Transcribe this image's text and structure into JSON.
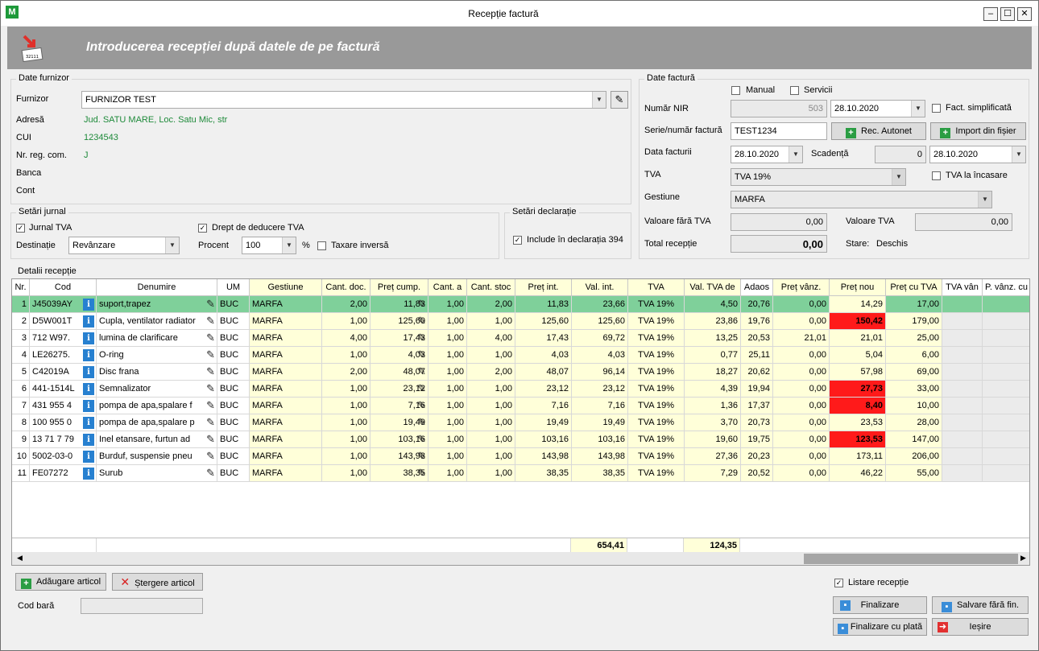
{
  "window": {
    "title": "Recepție factură",
    "app_icon": "app-logo-icon"
  },
  "banner": {
    "heading": "Introducerea recepției după datele de pe factură",
    "icon_text": "32111"
  },
  "supplier": {
    "group": "Date furnizor",
    "lbl_furnizor": "Furnizor",
    "furnizor": "FURNIZOR TEST",
    "lbl_adresa": "Adresă",
    "adresa": "Jud. SATU MARE, Loc. Satu Mic, str",
    "lbl_cui": "CUI",
    "cui": "1234543",
    "lbl_nrreg": "Nr. reg. com.",
    "nrreg": "J",
    "lbl_banca": "Banca",
    "lbl_cont": "Cont"
  },
  "journal": {
    "group": "Setări jurnal",
    "jurnal_tva": "Jurnal TVA",
    "drept": "Drept de deducere TVA",
    "lbl_dest": "Destinație",
    "destinatie": "Revânzare",
    "lbl_procent": "Procent",
    "procent": "100",
    "pct": "%",
    "taxare": "Taxare inversă"
  },
  "declaration": {
    "group": "Setări declarație",
    "include": "Include în declarația 394"
  },
  "invoice": {
    "group": "Date factură",
    "manual": "Manual",
    "servicii": "Servicii",
    "lbl_nir": "Număr NIR",
    "nir": "503",
    "nir_date": "28.10.2020",
    "fact_simpl": "Fact. simplificată",
    "lbl_serie": "Serie/număr factură",
    "serie": "TEST1234",
    "rec_autonet": "Rec. Autonet",
    "import": "Import din fișier",
    "lbl_data": "Data facturii",
    "data": "28.10.2020",
    "lbl_scadenta": "Scadență",
    "scadenta_zile": "0",
    "scadenta_data": "28.10.2020",
    "lbl_tva": "TVA",
    "tva": "TVA 19%",
    "tva_incasare": "TVA la încasare",
    "lbl_gestiune": "Gestiune",
    "gestiune": "MARFA",
    "lbl_val_fara": "Valoare fără TVA",
    "val_fara": "0,00",
    "lbl_val_tva": "Valoare TVA",
    "val_tva": "0,00",
    "lbl_total": "Total recepție",
    "total": "0,00",
    "lbl_stare": "Stare:",
    "stare": "Deschis"
  },
  "details": {
    "group": "Detalii recepție"
  },
  "columns": [
    "Nr.",
    "Cod",
    "Denumire",
    "UM",
    "Gestiune",
    "Cant. doc.",
    "Preț cump.",
    "Cant. a",
    "Cant. stoc",
    "Preț int.",
    "Val. int.",
    "TVA",
    "Val. TVA de",
    "Adaos",
    "Preț vânz.",
    "Preț nou",
    "Preț cu TVA",
    "TVA vân",
    "P. vânz. cu"
  ],
  "rows": [
    {
      "nr": "1",
      "cod": "J45039AY",
      "den": "suport,trapez",
      "um": "BUC",
      "gest": "MARFA",
      "cdoc": "2,00",
      "pcump": "11,83",
      "canta": "1,00",
      "cstoc": "2,00",
      "pint": "11,83",
      "vint": "23,66",
      "tva": "TVA 19%",
      "vtva": "4,50",
      "adaos": "20,76",
      "pvanz": "0,00",
      "pnou": "14,29",
      "pcu": "17,00",
      "hl": false
    },
    {
      "nr": "2",
      "cod": "D5W001T",
      "den": "Cupla, ventilator radiator",
      "um": "BUC",
      "gest": "MARFA",
      "cdoc": "1,00",
      "pcump": "125,60",
      "canta": "1,00",
      "cstoc": "1,00",
      "pint": "125,60",
      "vint": "125,60",
      "tva": "TVA 19%",
      "vtva": "23,86",
      "adaos": "19,76",
      "pvanz": "0,00",
      "pnou": "150,42",
      "pcu": "179,00",
      "hl": true
    },
    {
      "nr": "3",
      "cod": "712 W97.",
      "den": "lumina de clarificare",
      "um": "BUC",
      "gest": "MARFA",
      "cdoc": "4,00",
      "pcump": "17,43",
      "canta": "1,00",
      "cstoc": "4,00",
      "pint": "17,43",
      "vint": "69,72",
      "tva": "TVA 19%",
      "vtva": "13,25",
      "adaos": "20,53",
      "pvanz": "21,01",
      "pnou": "21,01",
      "pcu": "25,00",
      "hl": false
    },
    {
      "nr": "4",
      "cod": "LE26275.",
      "den": "O-ring",
      "um": "BUC",
      "gest": "MARFA",
      "cdoc": "1,00",
      "pcump": "4,03",
      "canta": "1,00",
      "cstoc": "1,00",
      "pint": "4,03",
      "vint": "4,03",
      "tva": "TVA 19%",
      "vtva": "0,77",
      "adaos": "25,11",
      "pvanz": "0,00",
      "pnou": "5,04",
      "pcu": "6,00",
      "hl": false
    },
    {
      "nr": "5",
      "cod": "C42019A",
      "den": "Disc frana",
      "um": "BUC",
      "gest": "MARFA",
      "cdoc": "2,00",
      "pcump": "48,07",
      "canta": "1,00",
      "cstoc": "2,00",
      "pint": "48,07",
      "vint": "96,14",
      "tva": "TVA 19%",
      "vtva": "18,27",
      "adaos": "20,62",
      "pvanz": "0,00",
      "pnou": "57,98",
      "pcu": "69,00",
      "hl": false
    },
    {
      "nr": "6",
      "cod": "441-1514L",
      "den": "Semnalizator",
      "um": "BUC",
      "gest": "MARFA",
      "cdoc": "1,00",
      "pcump": "23,12",
      "canta": "1,00",
      "cstoc": "1,00",
      "pint": "23,12",
      "vint": "23,12",
      "tva": "TVA 19%",
      "vtva": "4,39",
      "adaos": "19,94",
      "pvanz": "0,00",
      "pnou": "27,73",
      "pcu": "33,00",
      "hl": true
    },
    {
      "nr": "7",
      "cod": "431 955 4",
      "den": "pompa de apa,spalare f",
      "um": "BUC",
      "gest": "MARFA",
      "cdoc": "1,00",
      "pcump": "7,16",
      "canta": "1,00",
      "cstoc": "1,00",
      "pint": "7,16",
      "vint": "7,16",
      "tva": "TVA 19%",
      "vtva": "1,36",
      "adaos": "17,37",
      "pvanz": "0,00",
      "pnou": "8,40",
      "pcu": "10,00",
      "hl": true
    },
    {
      "nr": "8",
      "cod": "100 955 0",
      "den": "pompa de apa,spalare p",
      "um": "BUC",
      "gest": "MARFA",
      "cdoc": "1,00",
      "pcump": "19,49",
      "canta": "1,00",
      "cstoc": "1,00",
      "pint": "19,49",
      "vint": "19,49",
      "tva": "TVA 19%",
      "vtva": "3,70",
      "adaos": "20,73",
      "pvanz": "0,00",
      "pnou": "23,53",
      "pcu": "28,00",
      "hl": false
    },
    {
      "nr": "9",
      "cod": "13 71 7 79",
      "den": "Inel etansare, furtun ad",
      "um": "BUC",
      "gest": "MARFA",
      "cdoc": "1,00",
      "pcump": "103,16",
      "canta": "1,00",
      "cstoc": "1,00",
      "pint": "103,16",
      "vint": "103,16",
      "tva": "TVA 19%",
      "vtva": "19,60",
      "adaos": "19,75",
      "pvanz": "0,00",
      "pnou": "123,53",
      "pcu": "147,00",
      "hl": true
    },
    {
      "nr": "10",
      "cod": "5002-03-0",
      "den": "Burduf, suspensie pneu",
      "um": "BUC",
      "gest": "MARFA",
      "cdoc": "1,00",
      "pcump": "143,98",
      "canta": "1,00",
      "cstoc": "1,00",
      "pint": "143,98",
      "vint": "143,98",
      "tva": "TVA 19%",
      "vtva": "27,36",
      "adaos": "20,23",
      "pvanz": "0,00",
      "pnou": "173,11",
      "pcu": "206,00",
      "hl": false
    },
    {
      "nr": "11",
      "cod": "FE07272",
      "den": "Surub",
      "um": "BUC",
      "gest": "MARFA",
      "cdoc": "1,00",
      "pcump": "38,35",
      "canta": "1,00",
      "cstoc": "1,00",
      "pint": "38,35",
      "vint": "38,35",
      "tva": "TVA 19%",
      "vtva": "7,29",
      "adaos": "20,52",
      "pvanz": "0,00",
      "pnou": "46,22",
      "pcu": "55,00",
      "hl": false
    }
  ],
  "totals": {
    "vint": "654,41",
    "vtva": "124,35"
  },
  "bottom": {
    "add": "Adăugare articol",
    "del": "Ștergere articol",
    "lbl_cod": "Cod bară",
    "listare": "Listare recepție",
    "finalizare": "Finalizare",
    "salvare": "Salvare fără fin.",
    "fin_plata": "Finalizare cu plată",
    "iesire": "Ieșire"
  }
}
